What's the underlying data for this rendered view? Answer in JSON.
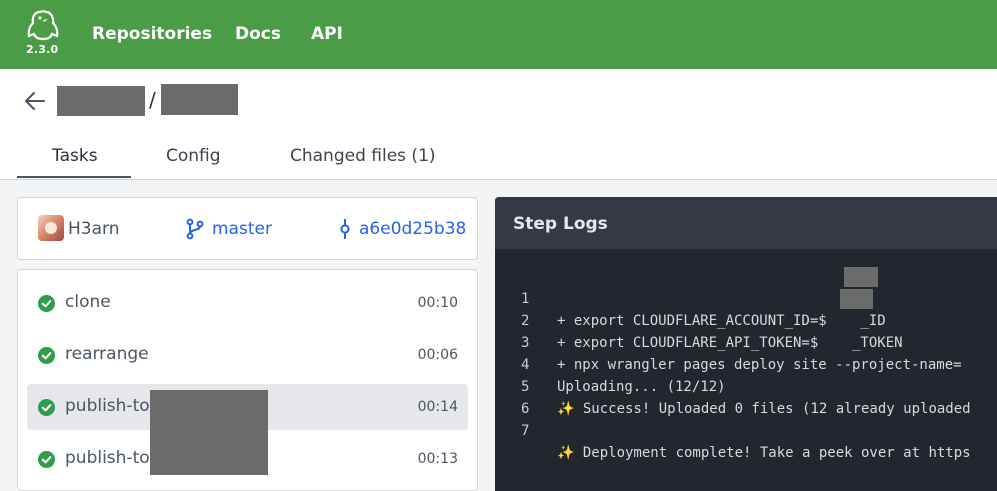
{
  "app": {
    "version": "2.3.0",
    "nav": [
      "Repositories",
      "Docs",
      "API"
    ]
  },
  "breadcrumb": {
    "separator": "/"
  },
  "tabs": [
    "Tasks",
    "Config",
    "Changed files (1)"
  ],
  "commit": {
    "author": "H3arn",
    "branch": "master",
    "sha": "a6e0d25b38"
  },
  "steps": [
    {
      "name": "clone",
      "time": "00:10"
    },
    {
      "name": "rearrange",
      "time": "00:06"
    },
    {
      "name": "publish-to-",
      "time": "00:14"
    },
    {
      "name": "publish-to-",
      "time": "00:13"
    }
  ],
  "logs": {
    "title": "Step Logs",
    "lines": [
      {
        "n": "1",
        "text": "+ export CLOUDFLARE_ACCOUNT_ID=$    _ID"
      },
      {
        "n": "2",
        "text": "+ export CLOUDFLARE_API_TOKEN=$    _TOKEN"
      },
      {
        "n": "3",
        "text": "+ npx wrangler pages deploy site --project-name="
      },
      {
        "n": "4",
        "text": "Uploading... (12/12)"
      },
      {
        "n": "5",
        "text": "✨ Success! Uploaded 0 files (12 already uploaded"
      },
      {
        "n": "6",
        "text": ""
      },
      {
        "n": "7",
        "text": "✨ Deployment complete! Take a peek over at https"
      }
    ]
  },
  "colors": {
    "nav_bg": "#4a9d46",
    "link": "#2563eb",
    "success": "#2e9e4b",
    "logs_bg": "#22262d"
  }
}
